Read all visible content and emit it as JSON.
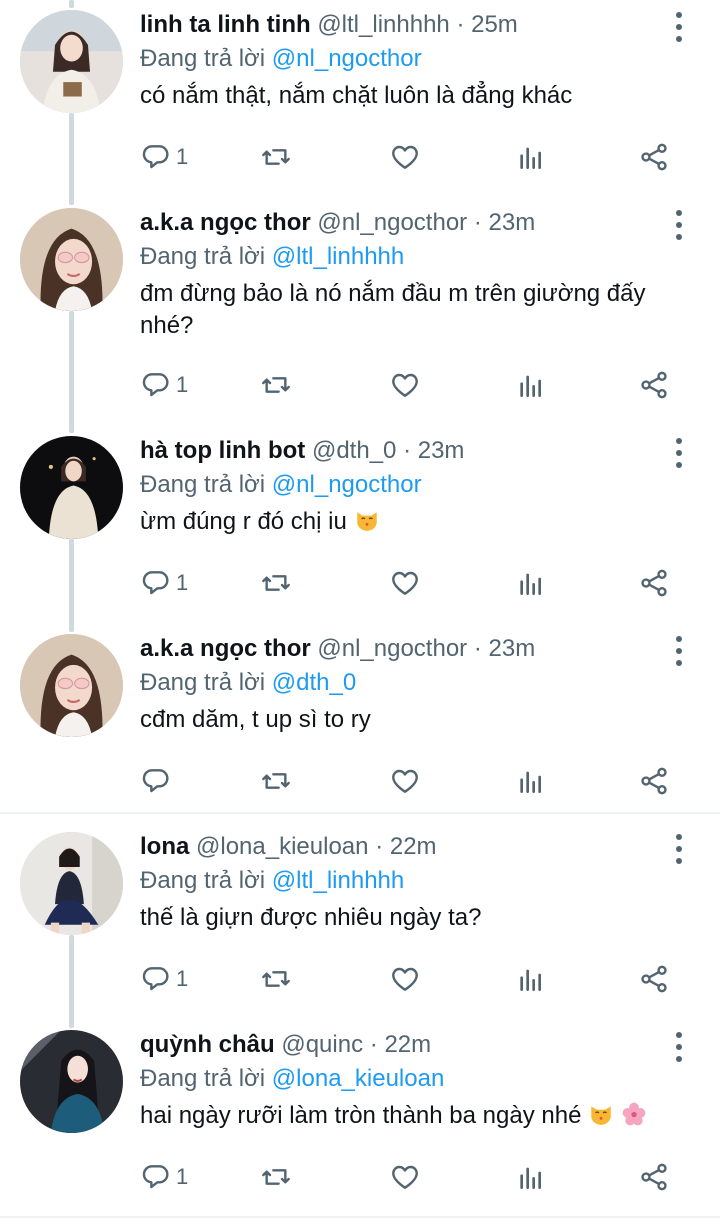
{
  "reply_prefix": "Đang trả lời",
  "tweets": [
    {
      "name": "linh ta linh tinh",
      "handle": "@ltl_linhhhh",
      "time": "25m",
      "reply_to": "@nl_ngocthor",
      "text": "có nắm thật, nắm chặt luôn là đẳng khác",
      "reply_count": "1"
    },
    {
      "name": "a.k.a ngọc thor",
      "handle": "@nl_ngocthor",
      "time": "23m",
      "reply_to": "@ltl_linhhhh",
      "text": "đm đừng bảo là nó nắm đầu m trên giường đấy nhé?",
      "reply_count": "1"
    },
    {
      "name": "hà top linh bot",
      "handle": "@dth_0",
      "time": "23m",
      "reply_to": "@nl_ngocthor",
      "text": "ừm đúng r đó chị iu",
      "reply_count": "1"
    },
    {
      "name": "a.k.a ngọc thor",
      "handle": "@nl_ngocthor",
      "time": "23m",
      "reply_to": "@dth_0",
      "text": "cđm dăm, t up sì to ry",
      "reply_count": ""
    },
    {
      "name": "lona",
      "handle": "@lona_kieuloan",
      "time": "22m",
      "reply_to": "@ltl_linhhhh",
      "text": "thế là giựn được nhiêu ngày ta?",
      "reply_count": "1"
    },
    {
      "name": "quỳnh châu",
      "handle": "@quinc",
      "time": "22m",
      "reply_to": "@lona_kieuloan",
      "text": "hai ngày rưỡi làm tròn thành ba ngày nhé",
      "reply_count": "1"
    }
  ],
  "icons": {
    "reply": "reply-icon",
    "retweet": "retweet-icon",
    "like": "heart-icon",
    "views": "analytics-icon",
    "share": "share-icon",
    "more": "more-vertical-icon"
  },
  "colors": {
    "link": "#1d9bf0",
    "secondary_text": "#536471",
    "thread_line": "#cfd9de"
  }
}
